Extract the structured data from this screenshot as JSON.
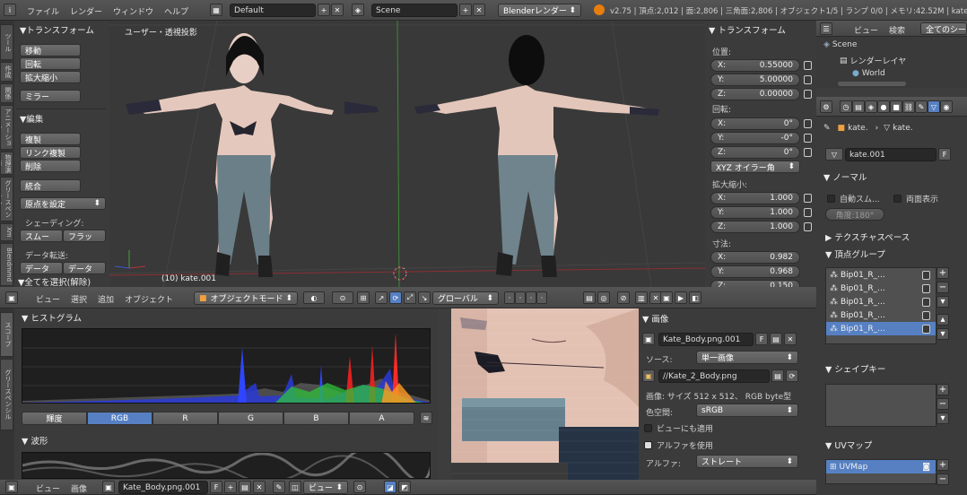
{
  "top_bar": {
    "menus": [
      "ファイル",
      "レンダー",
      "ウィンドウ",
      "ヘルプ"
    ],
    "screen_layout": "Default",
    "scene": "Scene",
    "render_engine": "Blenderレンダー",
    "stats": "v2.75 | 頂点:2,012 | 面:2,806 | 三角面:2,806 | オブジェクト1/5 | ランプ 0/0 | メモリ:42.52M | kate"
  },
  "outliner": {
    "header_menus": [
      "ビュー",
      "検索"
    ],
    "scene_selector": "全てのシーン",
    "items": [
      "Scene",
      "レンダーレイヤ",
      "World"
    ]
  },
  "tool_shelf": {
    "tabs": [
      "ツール",
      "作成",
      "関係",
      "アニメーション",
      "物理演算",
      "グリースペンシル",
      "Xm",
      "Blendmmd"
    ],
    "transform_header": "▼トランスフォーム",
    "transform_buttons": [
      "移動",
      "回転",
      "拡大縮小"
    ],
    "mirror": "ミラー",
    "edit_header": "▼編集",
    "edit_buttons": [
      "複製",
      "リンク複製",
      "削除"
    ],
    "join": "統合",
    "set_origin": "原点を設定",
    "shading_label": "シェーディング:",
    "shading_buttons": [
      "スムー",
      "フラッ"
    ],
    "data_transfer_label": "データ転送:",
    "data_buttons": [
      "データ",
      "データ"
    ],
    "footer": "▼全てを選択(解除)"
  },
  "viewport": {
    "label": "ユーザー・透視投影",
    "object_name": "(10) kate.001",
    "header": {
      "menus": [
        "ビュー",
        "選択",
        "追加",
        "オブジェクト"
      ],
      "mode": "オブジェクトモード",
      "orientation": "グローバル"
    }
  },
  "properties_n": {
    "transform_header": "▼ トランスフォーム",
    "location_label": "位置:",
    "location": [
      {
        "axis": "X:",
        "value": "0.55000"
      },
      {
        "axis": "Y:",
        "value": "5.00000"
      },
      {
        "axis": "Z:",
        "value": "0.00000"
      }
    ],
    "rotation_label": "回転:",
    "rotation": [
      {
        "axis": "X:",
        "value": "0°"
      },
      {
        "axis": "Y:",
        "value": "-0°"
      },
      {
        "axis": "Z:",
        "value": "0°"
      }
    ],
    "rotation_mode": "XYZ オイラー角",
    "scale_label": "拡大縮小:",
    "scale": [
      {
        "axis": "X:",
        "value": "1.000"
      },
      {
        "axis": "Y:",
        "value": "1.000"
      },
      {
        "axis": "Z:",
        "value": "1.000"
      }
    ],
    "dimensions_label": "寸法:",
    "dimensions": [
      {
        "axis": "X:",
        "value": "0.982"
      },
      {
        "axis": "Y:",
        "value": "0.968"
      },
      {
        "axis": "Z:",
        "value": "0.150"
      }
    ]
  },
  "properties_editor": {
    "breadcrumb": [
      "kate.",
      "kate."
    ],
    "mesh_name": "kate.001",
    "fake_user": "F",
    "normals_header": "▼ ノーマル",
    "auto_smooth": "自動スム...",
    "double_sided": "両面表示",
    "angle": "角度:180°",
    "texture_space_header": "▶ テクスチャスペース",
    "vertex_groups_header": "▼ 頂点グループ",
    "vertex_groups": [
      "Bip01_R_...",
      "Bip01_R_...",
      "Bip01_R_...",
      "Bip01_R_...",
      "Bip01_R_..."
    ],
    "shape_keys_header": "▼ シェイプキー",
    "uv_maps_header": "▼ UVマップ",
    "uv_maps": [
      "UVMap"
    ]
  },
  "scopes": {
    "tabs": [
      "スコープ",
      "グリースペンシル"
    ],
    "histogram_header": "▼ ヒストグラム",
    "channels": [
      "輝度",
      "RGB",
      "R",
      "G",
      "B",
      "A"
    ],
    "active_channel": "RGB",
    "waveform_header": "▼ 波形"
  },
  "image_panel": {
    "header": "▼ 画像",
    "image_name": "Kate_Body.png.001",
    "fake_user": "F",
    "source_label": "ソース:",
    "source": "単一画像",
    "filepath": "//Kate_2_Body.png",
    "info": "画像: サイズ 512 x 512、 RGB byte型",
    "color_space_label": "色空間:",
    "color_space": "sRGB",
    "view_as_render": "ビューにも適用",
    "use_alpha": "アルファを使用",
    "alpha_label": "アルファ:",
    "alpha_mode": "ストレート"
  },
  "bottom_bar": {
    "menus": [
      "ビュー",
      "画像"
    ],
    "image_name": "Kate_Body.png.001",
    "fake_user": "F",
    "view_mode": "ビュー"
  },
  "colors": {
    "accent": "#5680c2",
    "axis_x": "#b8333a",
    "axis_y": "#47a23b",
    "axis_z": "#3a55d0"
  }
}
